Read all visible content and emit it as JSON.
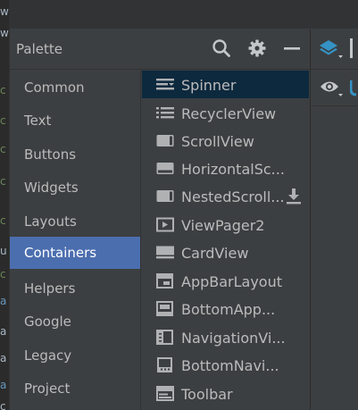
{
  "palette": {
    "title": "Palette",
    "header_icons": [
      "search-icon",
      "gear-icon",
      "minimize-icon"
    ],
    "categories": [
      {
        "label": "Common",
        "selected": false
      },
      {
        "label": "Text",
        "selected": false
      },
      {
        "label": "Buttons",
        "selected": false
      },
      {
        "label": "Widgets",
        "selected": false
      },
      {
        "label": "Layouts",
        "selected": false
      },
      {
        "label": "Containers",
        "selected": true
      },
      {
        "label": "Helpers",
        "selected": false
      },
      {
        "label": "Google",
        "selected": false
      },
      {
        "label": "Legacy",
        "selected": false
      },
      {
        "label": "Project",
        "selected": false
      }
    ],
    "components": [
      {
        "label": "Spinner",
        "icon": "spinner-icon",
        "selected": true
      },
      {
        "label": "RecyclerView",
        "icon": "list-icon"
      },
      {
        "label": "ScrollView",
        "icon": "scrollview-icon"
      },
      {
        "label": "HorizontalSc...",
        "icon": "horizontal-scrollview-icon"
      },
      {
        "label": "NestedScroll...",
        "icon": "nested-scrollview-icon",
        "downloadable": true
      },
      {
        "label": "ViewPager2",
        "icon": "viewpager-icon"
      },
      {
        "label": "CardView",
        "icon": "cardview-icon"
      },
      {
        "label": "AppBarLayout",
        "icon": "appbar-icon"
      },
      {
        "label": "BottomApp...",
        "icon": "bottom-appbar-icon"
      },
      {
        "label": "NavigationVi...",
        "icon": "navigation-view-icon"
      },
      {
        "label": "BottomNavi...",
        "icon": "bottom-navigation-icon"
      },
      {
        "label": "Toolbar",
        "icon": "toolbar-icon"
      }
    ]
  },
  "right_panel": {
    "icons": [
      "layers-icon",
      "eye-icon"
    ]
  },
  "colors": {
    "panel_bg": "#3c3f41",
    "selected_category": "#4b6eaf",
    "selected_component": "#0d293e",
    "text": "#bbbbbb"
  }
}
